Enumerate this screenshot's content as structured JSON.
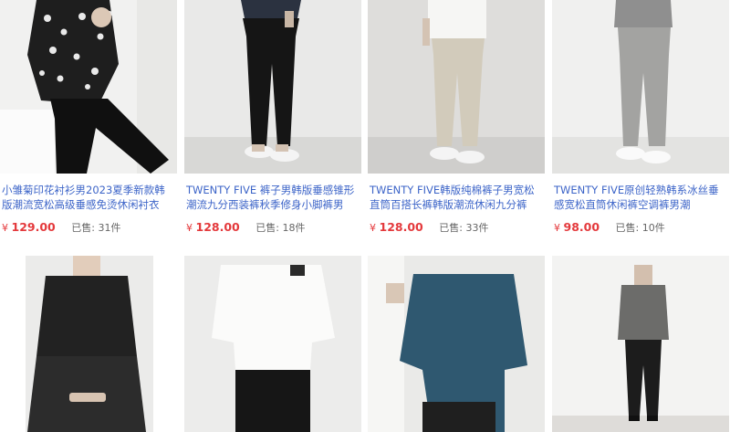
{
  "products": [
    {
      "title": "小雏菊印花衬衫男2023夏季新款韩版潮流宽松高级垂感免烫休闲衬衣",
      "currency": "¥",
      "price": "129.00",
      "sold_label": "已售:",
      "sold_count": "31件"
    },
    {
      "title": "TWENTY FIVE 裤子男韩版垂感锥形潮流九分西装裤秋季修身小脚裤男",
      "currency": "¥",
      "price": "128.00",
      "sold_label": "已售:",
      "sold_count": "18件"
    },
    {
      "title": "TWENTY FIVE韩版纯棉裤子男宽松直筒百搭长裤韩版潮流休闲九分裤",
      "currency": "¥",
      "price": "128.00",
      "sold_label": "已售:",
      "sold_count": "33件"
    },
    {
      "title": "TWENTY FIVE原创轻熟韩系冰丝垂感宽松直筒休闲裤空调裤男潮",
      "currency": "¥",
      "price": "98.00",
      "sold_label": "已售:",
      "sold_count": "10件"
    }
  ],
  "colors": {
    "link": "#3c64c8",
    "price": "#e4393c"
  }
}
